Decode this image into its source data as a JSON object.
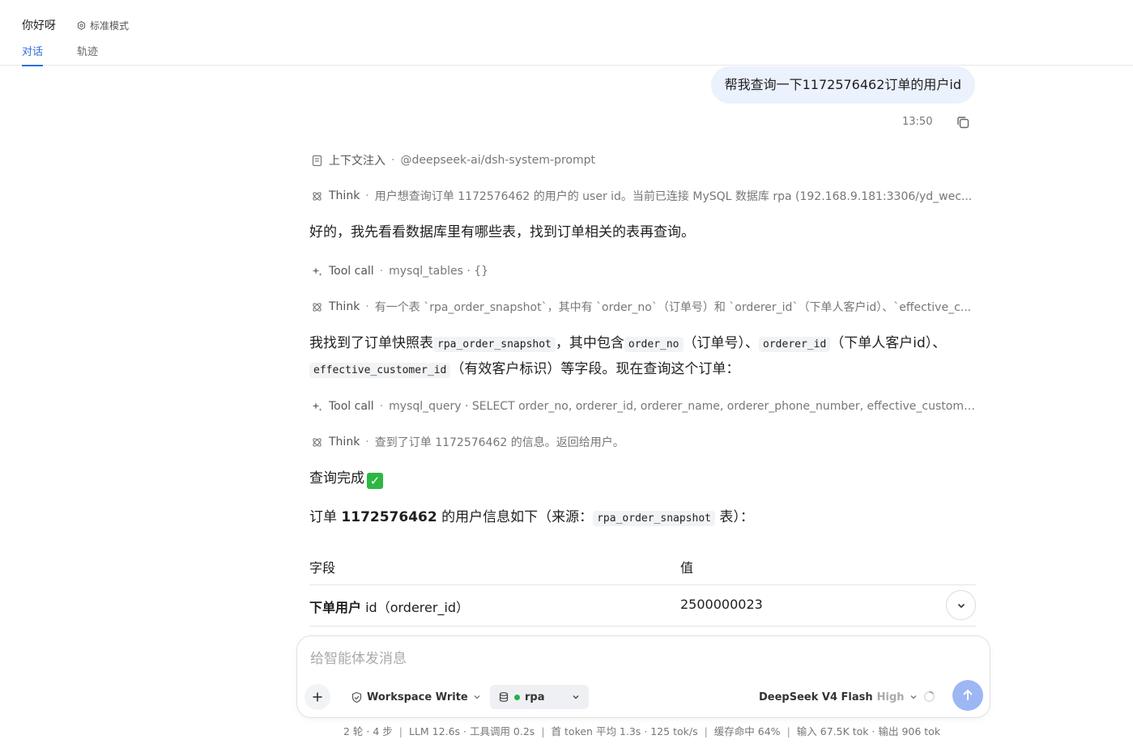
{
  "header": {
    "title": "你好呀",
    "mode": "标准模式",
    "tabs": [
      {
        "label": "对话",
        "active": true
      },
      {
        "label": "轨迹",
        "active": false
      }
    ]
  },
  "user_message": {
    "text": "帮我查询一下1172576462订单的用户id",
    "time": "13:50"
  },
  "assistant": {
    "context": {
      "label": "上下文注入",
      "detail": "@deepseek-ai/dsh-system-prompt"
    },
    "think1": {
      "label": "Think",
      "detail": "用户想查询订单 1172576462 的用户的 user id。当前已连接 MySQL 数据库 rpa (192.168.9.181:3306/yd_wec..."
    },
    "reply1": "好的，我先看看数据库里有哪些表，找到订单相关的表再查询。",
    "tool1": {
      "label": "Tool call",
      "detail": "mysql_tables · {}"
    },
    "think2": {
      "label": "Think",
      "detail": "有一个表 `rpa_order_snapshot`，其中有 `order_no`（订单号）和 `orderer_id`（下单人客户id）、`effective_c..."
    },
    "reply2": {
      "t1": "我找到了订单快照表",
      "c1": "rpa_order_snapshot",
      "t2": "，其中包含",
      "c2": "order_no",
      "t3": "（订单号）、",
      "c3": "orderer_id",
      "t4": "（下单人客户id）、",
      "c4": "effective_customer_id",
      "t5": "（有效客户标识）等字段。现在查询这个订单："
    },
    "tool2": {
      "label": "Tool call",
      "detail": "mysql_query · SELECT order_no, orderer_id, orderer_name, orderer_phone_number, effective_customer_ty..."
    },
    "think3": {
      "label": "Think",
      "detail": "查到了订单 1172576462 的信息。返回给用户。"
    },
    "done": "查询完成",
    "done_emoji": "✓",
    "summary": {
      "t1": "订单 ",
      "b1": "1172576462",
      "t2": " 的用户信息如下（来源：",
      "c1": "rpa_order_snapshot",
      "t3": " 表）："
    },
    "table": {
      "headers": [
        "字段",
        "值"
      ],
      "rows": [
        {
          "field_bold": "下单用户",
          "field_rest": " id（orderer_id）",
          "value": "2500000023"
        }
      ]
    }
  },
  "composer": {
    "placeholder": "给智能体发消息",
    "workspace": "Workspace Write",
    "database": "rpa",
    "model": "DeepSeek V4 Flash",
    "level": "High"
  },
  "stats": [
    "2 轮 · 4 步",
    "LLM 12.6s · 工具调用 0.2s",
    "首 token 平均 1.3s · 125 tok/s",
    "缓存命中 64%",
    "输入 67.5K tok · 输出 906 tok"
  ],
  "colors": {
    "accent": "#2f6fdc",
    "bubble": "#ebf1fd",
    "send": "#9db6f4",
    "connected": "#22b14c"
  }
}
